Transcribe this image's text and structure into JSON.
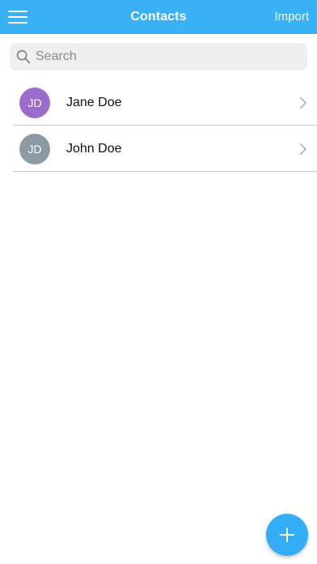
{
  "header": {
    "title": "Contacts",
    "menu_icon": "hamburger-menu-icon",
    "import_label": "Import",
    "background_color": "#3ab0f5"
  },
  "search": {
    "placeholder": "Search",
    "value": "",
    "icon": "search-icon"
  },
  "contacts": [
    {
      "initials": "JD",
      "name": "Jane Doe",
      "avatar_color": "#9b6dcb"
    },
    {
      "initials": "JD",
      "name": "John Doe",
      "avatar_color": "#8c9ba3"
    }
  ],
  "fab": {
    "icon": "plus-icon",
    "color": "#33adf5"
  }
}
